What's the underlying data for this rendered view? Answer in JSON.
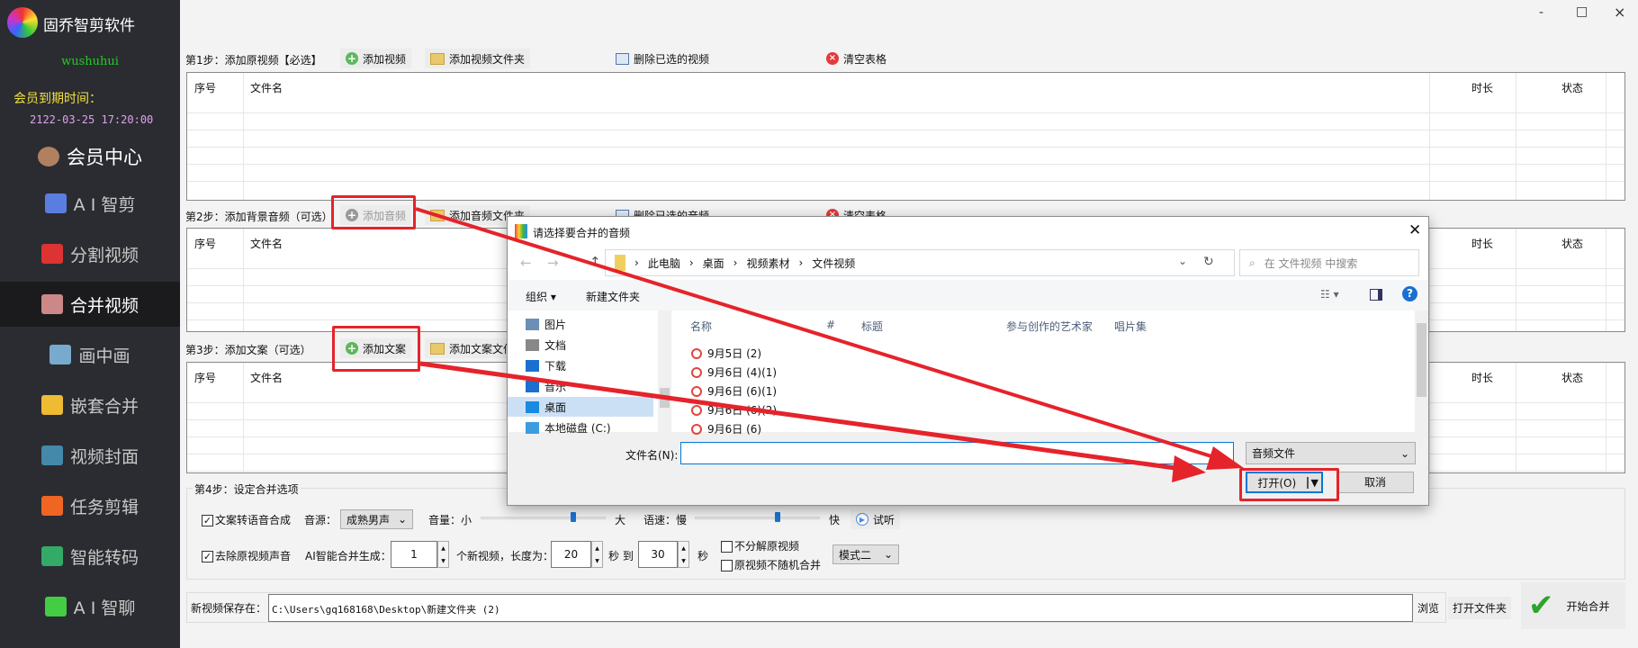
{
  "app": {
    "title": "固乔智剪软件",
    "username": "wushuhui",
    "expiry_label": "会员到期时间：",
    "expiry_time": "2122-03-25 17:20:00",
    "member_center": "会员中心"
  },
  "sidebar": {
    "items": [
      {
        "label": "A I 智剪",
        "icon": "magic-wand-icon"
      },
      {
        "label": "分割视频",
        "icon": "split-layers-icon"
      },
      {
        "label": "合并视频",
        "icon": "merge-icon",
        "active": true
      },
      {
        "label": "画中画",
        "icon": "picture-in-picture-icon"
      },
      {
        "label": "嵌套合并",
        "icon": "nested-merge-icon"
      },
      {
        "label": "视频封面",
        "icon": "cover-image-icon"
      },
      {
        "label": "任务剪辑",
        "icon": "flower-icon"
      },
      {
        "label": "智能转码",
        "icon": "transcode-icon"
      },
      {
        "label": "A I 智聊",
        "icon": "chat-icon"
      }
    ]
  },
  "window": {
    "minimize": "-",
    "maximize": "□",
    "close": "×"
  },
  "step1": {
    "label": "第1步：添加原视频【必选】",
    "add": "添加视频",
    "add_folder": "添加视频文件夹",
    "delete": "删除已选的视频",
    "clear": "清空表格"
  },
  "step2": {
    "label": "第2步：添加背景音频（可选）",
    "add": "添加音频",
    "add_folder": "添加音频文件夹",
    "delete": "删除已选的音频",
    "clear": "清空表格"
  },
  "step3": {
    "label": "第3步：添加文案（可选）",
    "add": "添加文案",
    "add_folder": "添加文案文件夹"
  },
  "table": {
    "col_index": "序号",
    "col_name": "文件名",
    "col_duration": "时长",
    "col_status": "状态"
  },
  "step4": {
    "label": "第4步：设定合并选项",
    "tts": {
      "label": "文案转语音合成",
      "checked": true
    },
    "voice_label": "音源：",
    "voice": "成熟男声",
    "volume_label": "音量：小",
    "volume_max": "大",
    "volume": 0.75,
    "speed_label": "语速：慢",
    "speed_max": "快",
    "speed": 0.67,
    "preview": "试听",
    "mute": {
      "label": "去除原视频声音",
      "checked": true
    },
    "ai_label": "AI智能合并生成：",
    "count": "1",
    "count_unit": "个新视频，长度为：",
    "min_len": "20",
    "to_label": "秒 到",
    "max_len": "30",
    "sec": "秒",
    "no_split": {
      "label": "不分解原视频",
      "checked": false
    },
    "no_random": {
      "label": "原视频不随机合并",
      "checked": false
    },
    "mode": "模式二"
  },
  "save": {
    "label": "新视频保存在：",
    "path": "C:\\Users\\gq168168\\Desktop\\新建文件夹 (2)",
    "browse": "浏览",
    "open_folder": "打开文件夹",
    "start": "开始合并"
  },
  "dialog": {
    "title": "请选择要合并的音频",
    "breadcrumb": [
      "此电脑",
      "桌面",
      "视频素材",
      "文件视频"
    ],
    "search_placeholder": "在 文件视频 中搜索",
    "organize": "组织 ▾",
    "new_folder": "新建文件夹",
    "nav": [
      "图片",
      "文档",
      "下载",
      "音乐",
      "桌面",
      "本地磁盘 (C:)"
    ],
    "columns": [
      "名称",
      "#",
      "标题",
      "参与创作的艺术家",
      "唱片集"
    ],
    "files": [
      "9月5日 (2)",
      "9月6日 (4)(1)",
      "9月6日 (6)(1)",
      "9月6日 (6)(2)",
      "9月6日 (6)"
    ],
    "filename_label": "文件名(N):",
    "filename": "",
    "filetype": "音频文件",
    "open": "打开(O)",
    "cancel": "取消"
  },
  "colors": {
    "sidebar_bg": "#2b2c31",
    "highlight": "#e5232a",
    "accent": "#0078d7",
    "username": "#22cc22",
    "expiry": "#f0e040",
    "date": "#e0a0f0"
  }
}
